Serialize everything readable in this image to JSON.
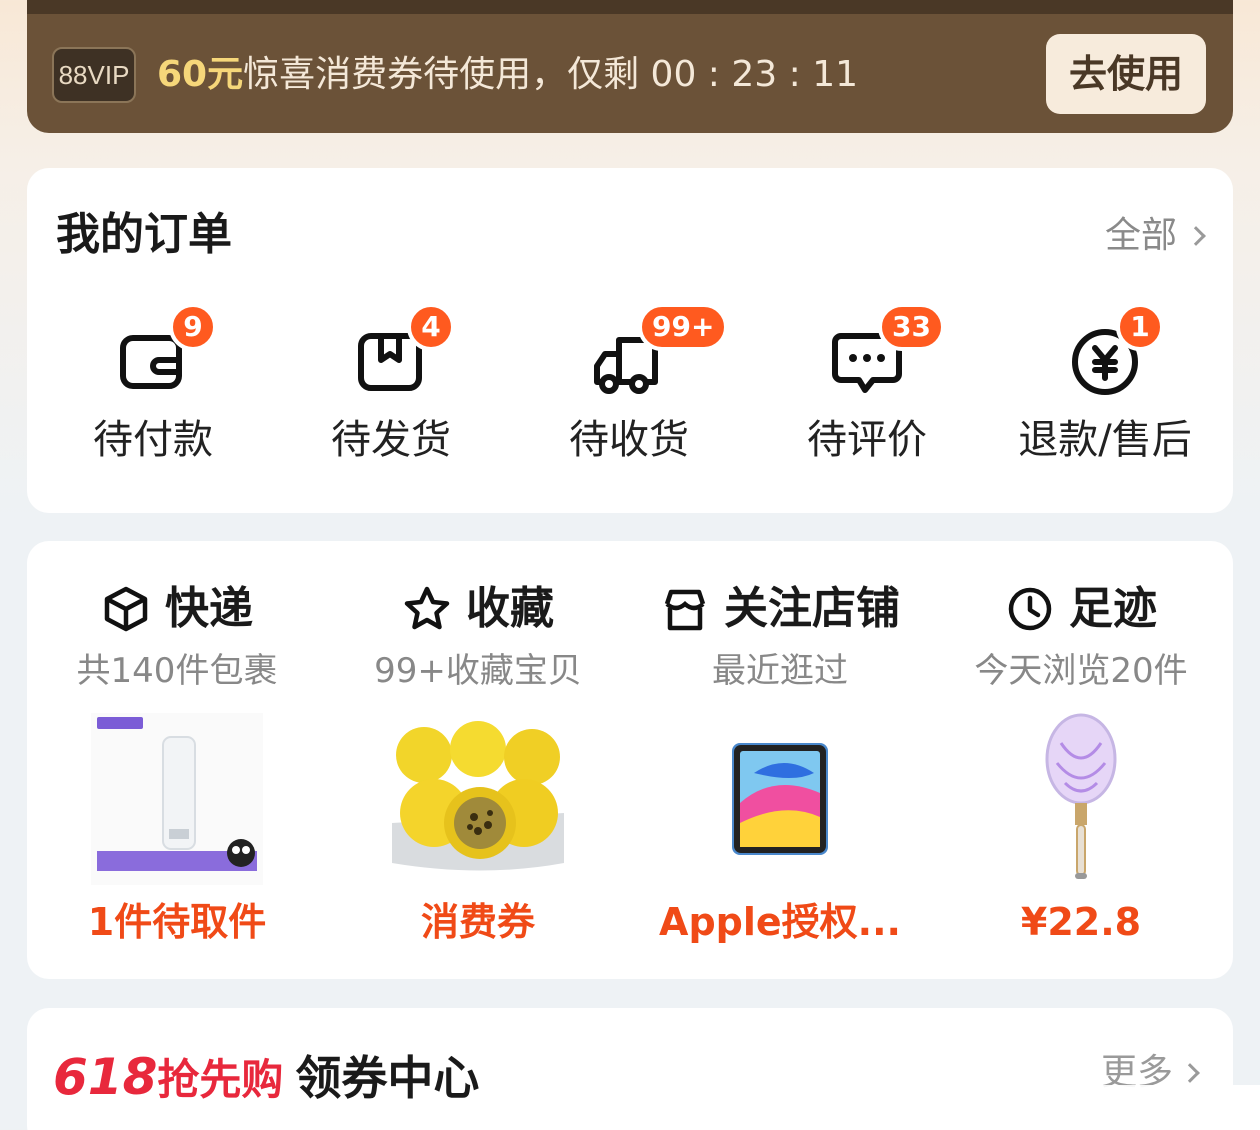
{
  "vip_banner": {
    "badge": "88VIP",
    "amount": "60元",
    "message": "惊喜消费券待使用，仅剩 00 : 23 : 11",
    "button": "去使用"
  },
  "orders": {
    "title": "我的订单",
    "all_label": "全部",
    "items": [
      {
        "label": "待付款",
        "badge": "9",
        "icon": "wallet-icon"
      },
      {
        "label": "待发货",
        "badge": "4",
        "icon": "package-icon"
      },
      {
        "label": "待收货",
        "badge": "99+",
        "icon": "truck-icon"
      },
      {
        "label": "待评价",
        "badge": "33",
        "icon": "chat-icon"
      },
      {
        "label": "退款/售后",
        "badge": "1",
        "icon": "refund-icon"
      }
    ]
  },
  "shortcuts": [
    {
      "title": "快递",
      "subtitle": "共140件包裹",
      "footer": "1件待取件",
      "icon": "box-icon",
      "image": "skincare-tube-image"
    },
    {
      "title": "收藏",
      "subtitle": "99+收藏宝贝",
      "footer": "消费券",
      "icon": "star-icon",
      "image": "passion-fruit-image"
    },
    {
      "title": "关注店铺",
      "subtitle": "最近逛过",
      "footer": "Apple授权...",
      "icon": "store-icon",
      "image": "ipad-image"
    },
    {
      "title": "足迹",
      "subtitle": "今天浏览20件",
      "footer": "¥22.8",
      "icon": "clock-icon",
      "image": "mosquito-swatter-image"
    }
  ],
  "coupon_center": {
    "brand_number": "618",
    "brand_text": "抢先购",
    "title": "领券中心",
    "more_label": "更多"
  },
  "colors": {
    "banner_bg": "#6b5238",
    "accent_orange": "#f04a17",
    "badge_orange": "#ff5a1f",
    "brand_red": "#e8283c"
  }
}
